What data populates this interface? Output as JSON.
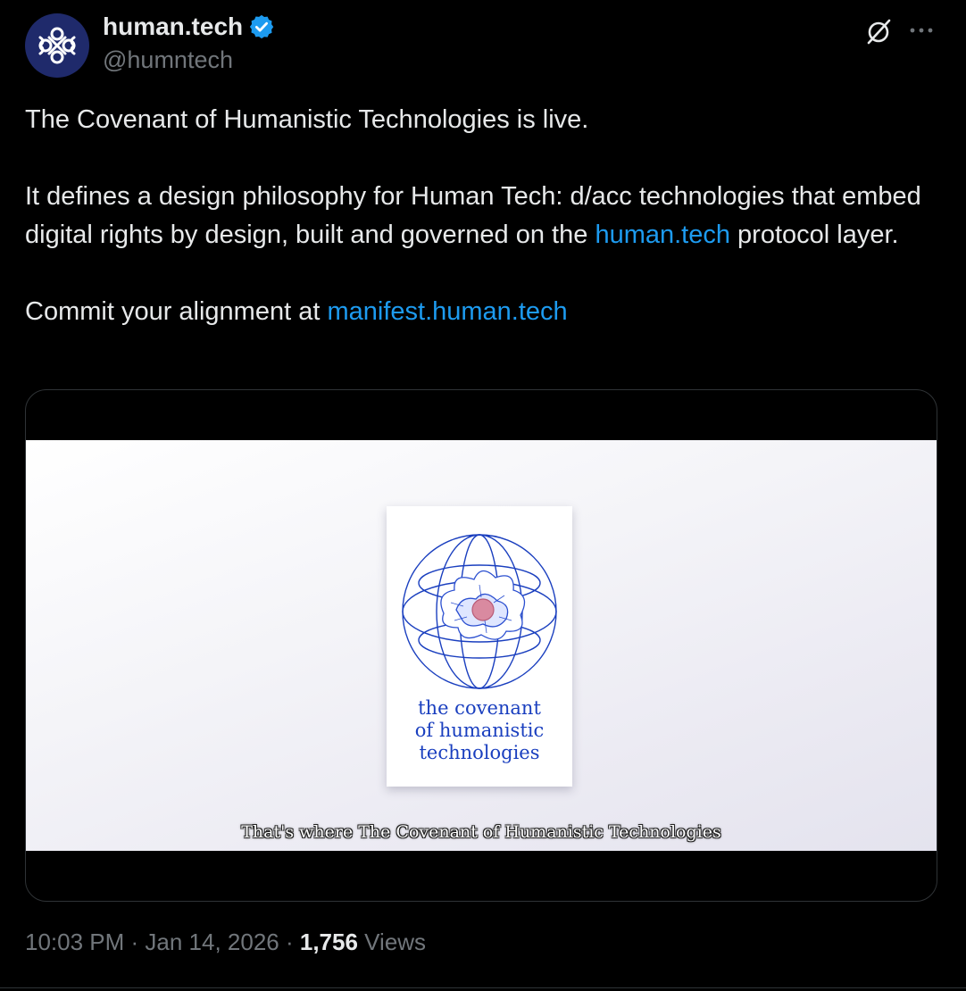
{
  "author": {
    "display_name": "human.tech",
    "handle": "@humntech",
    "avatar_icon": "human-tech-logo-icon",
    "verified_icon": "verified-badge-icon",
    "verified_color": "#1d9bf0"
  },
  "header_actions": {
    "grok_icon": "grok-icon",
    "more_icon": "more-options-icon"
  },
  "body": {
    "line1": "The Covenant of Humanistic Technologies is live.",
    "para2_before": "It defines a design philosophy for Human Tech: d/acc technologies that embed digital rights by design, built and governed on the ",
    "para2_link": "human.tech",
    "para2_after": " protocol layer.",
    "para3_before": "Commit your alignment at ",
    "para3_link": "manifest.human.tech"
  },
  "media": {
    "card_title_line1": "the covenant",
    "card_title_line2": "of humanistic",
    "card_title_line3": "technologies",
    "subtitle": "That's where The Covenant of Humanistic Technologies",
    "accent_color": "#1a3fbf"
  },
  "meta": {
    "time": "10:03 PM",
    "separator": " · ",
    "date": "Jan 14, 2026",
    "views_count": "1,756",
    "views_label": " Views"
  },
  "colors": {
    "background": "#000000",
    "text": "#e7e9ea",
    "muted": "#71767b",
    "link": "#1d9bf0"
  }
}
